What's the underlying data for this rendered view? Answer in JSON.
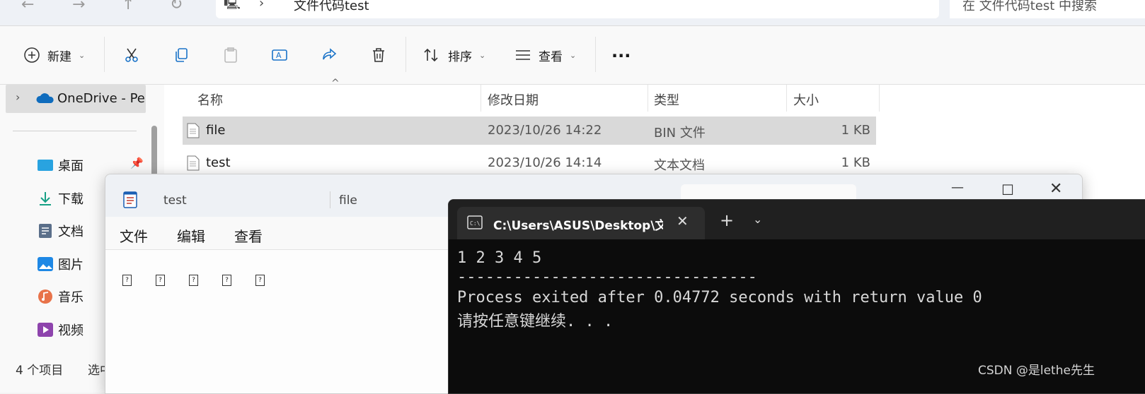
{
  "explorer": {
    "address": "文件代码test",
    "search_placeholder": "在 文件代码test 中搜索",
    "toolbar": {
      "new_label": "新建",
      "sort_label": "排序",
      "view_label": "查看",
      "more_label": "..."
    },
    "sidebar": {
      "onedrive": "OneDrive - Per",
      "items": [
        {
          "label": "桌面",
          "icon": "desktop-icon"
        },
        {
          "label": "下载",
          "icon": "download-icon"
        },
        {
          "label": "文档",
          "icon": "document-icon"
        },
        {
          "label": "图片",
          "icon": "pictures-icon"
        },
        {
          "label": "音乐",
          "icon": "music-icon"
        },
        {
          "label": "视频",
          "icon": "video-icon"
        }
      ]
    },
    "columns": {
      "name": "名称",
      "date": "修改日期",
      "type": "类型",
      "size": "大小"
    },
    "files": [
      {
        "name": "file",
        "date": "2023/10/26 14:22",
        "type": "BIN 文件",
        "size": "1 KB",
        "selected": true
      },
      {
        "name": "test",
        "date": "2023/10/26 14:14",
        "type": "文本文档",
        "size": "1 KB",
        "selected": false
      }
    ],
    "status": {
      "count": "4 个项目",
      "selected": "选中"
    }
  },
  "notepad": {
    "tabs": [
      "test",
      "file"
    ],
    "menu": {
      "file": "文件",
      "edit": "编辑",
      "view": "查看"
    },
    "content_boxes": [
      "?",
      "?",
      "?",
      "?",
      "?"
    ]
  },
  "terminal": {
    "tab_title": "C:\\Users\\ASUS\\Desktop\\文件",
    "lines": [
      "1 2 3 4 5",
      "--------------------------------",
      "Process exited after 0.04772 seconds with return value 0",
      "请按任意键继续. . ."
    ]
  },
  "watermark": "CSDN @是lethe先生",
  "colors": {
    "selection": "#d9d9d9",
    "terminal_bg": "#0c0c0c",
    "accent": "#0067c0"
  }
}
